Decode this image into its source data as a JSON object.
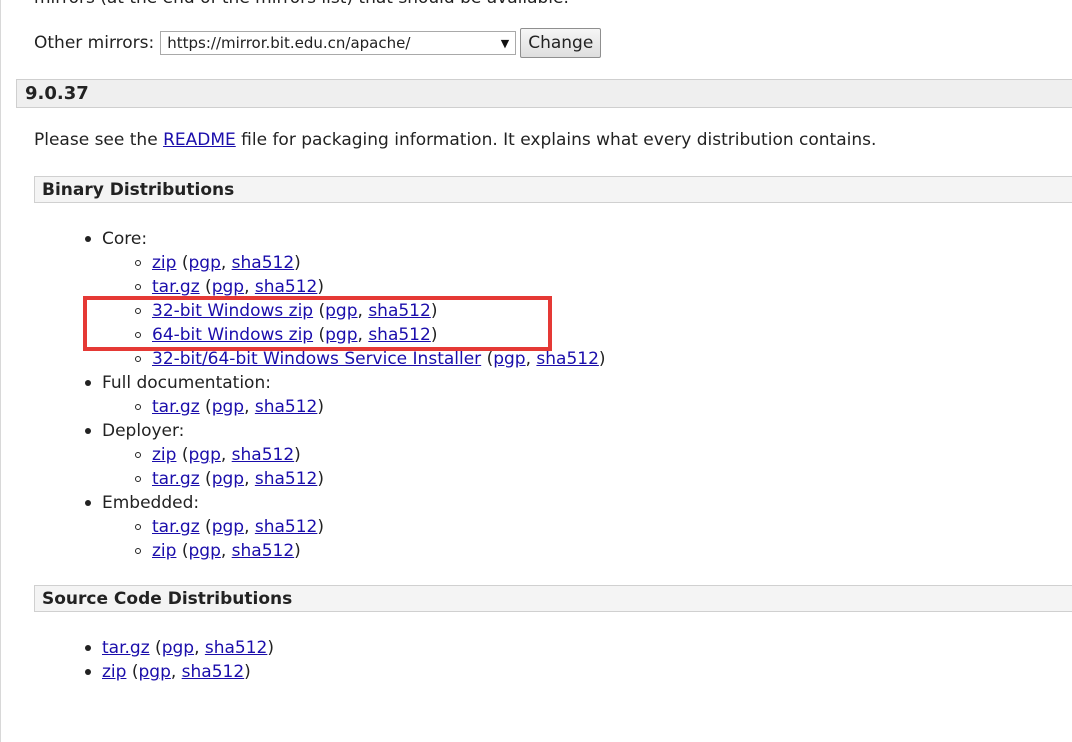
{
  "top_text": "mirrors (at the end of the mirrors list) that should be available.",
  "mirrors": {
    "label": "Other mirrors:",
    "selected": "https://mirror.bit.edu.cn/apache/",
    "change_button": "Change"
  },
  "version": "9.0.37",
  "readme": {
    "prefix": "Please see the ",
    "link": "README",
    "suffix": " file for packaging information. It explains what every distribution contains."
  },
  "binary": {
    "title": "Binary Distributions",
    "groups": [
      {
        "label": "Core:",
        "items": [
          {
            "main": "zip",
            "pgp": "pgp",
            "sha": "sha512"
          },
          {
            "main": "tar.gz",
            "pgp": "pgp",
            "sha": "sha512"
          },
          {
            "main": "32-bit Windows zip",
            "pgp": "pgp",
            "sha": "sha512"
          },
          {
            "main": "64-bit Windows zip",
            "pgp": "pgp",
            "sha": "sha512"
          },
          {
            "main": "32-bit/64-bit Windows Service Installer",
            "pgp": "pgp",
            "sha": "sha512"
          }
        ]
      },
      {
        "label": "Full documentation:",
        "items": [
          {
            "main": "tar.gz",
            "pgp": "pgp",
            "sha": "sha512"
          }
        ]
      },
      {
        "label": "Deployer:",
        "items": [
          {
            "main": "zip",
            "pgp": "pgp",
            "sha": "sha512"
          },
          {
            "main": "tar.gz",
            "pgp": "pgp",
            "sha": "sha512"
          }
        ]
      },
      {
        "label": "Embedded:",
        "items": [
          {
            "main": "tar.gz",
            "pgp": "pgp",
            "sha": "sha512"
          },
          {
            "main": "zip",
            "pgp": "pgp",
            "sha": "sha512"
          }
        ]
      }
    ]
  },
  "source": {
    "title": "Source Code Distributions",
    "items": [
      {
        "main": "tar.gz",
        "pgp": "pgp",
        "sha": "sha512"
      },
      {
        "main": "zip",
        "pgp": "pgp",
        "sha": "sha512"
      }
    ]
  },
  "colors": {
    "highlight": "#e53935",
    "link": "#1a0dab"
  }
}
